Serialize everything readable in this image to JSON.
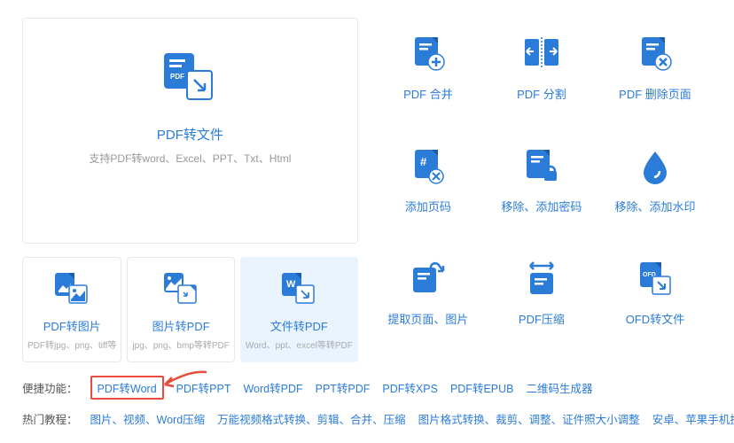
{
  "hero": {
    "title": "PDF转文件",
    "subtitle": "支持PDF转word、Excel、PPT、Txt、Html"
  },
  "smallCards": [
    {
      "title": "PDF转图片",
      "sub": "PDF转jpg、png、tiff等"
    },
    {
      "title": "图片转PDF",
      "sub": "jpg、png、bmp等转PDF"
    },
    {
      "title": "文件转PDF",
      "sub": "Word、ppt、excel等转PDF"
    }
  ],
  "gridItems": [
    {
      "title": "PDF 合并"
    },
    {
      "title": "PDF 分割"
    },
    {
      "title": "PDF 删除页面"
    },
    {
      "title": "添加页码"
    },
    {
      "title": "移除、添加密码"
    },
    {
      "title": "移除、添加水印"
    },
    {
      "title": "提取页面、图片"
    },
    {
      "title": "PDF压缩"
    },
    {
      "title": "OFD转文件"
    }
  ],
  "footer": {
    "quickLabel": "便捷功能：",
    "quickLinks": [
      "PDF转Word",
      "PDF转PPT",
      "Word转PDF",
      "PPT转PDF",
      "PDF转XPS",
      "PDF转EPUB",
      "二维码生成器"
    ],
    "hotLabel": "热门教程：",
    "hotLinks": [
      "图片、视频、Word压缩",
      "万能视频格式转换、剪辑、合并、压缩",
      "图片格式转换、裁剪、调整、证件照大小调整",
      "安卓、苹果手机投屏到"
    ]
  }
}
